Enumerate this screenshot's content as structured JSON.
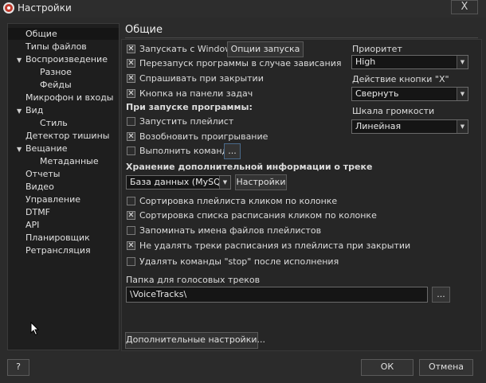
{
  "window": {
    "title": "Настройки",
    "close_label": "X"
  },
  "sidebar": {
    "items": [
      {
        "label": "Общие",
        "level": 0,
        "expander": ""
      },
      {
        "label": "Типы файлов",
        "level": 0,
        "expander": ""
      },
      {
        "label": "Воспроизведение",
        "level": 0,
        "expander": "▼"
      },
      {
        "label": "Разное",
        "level": 1,
        "expander": ""
      },
      {
        "label": "Фейды",
        "level": 1,
        "expander": ""
      },
      {
        "label": "Микрофон и входы",
        "level": 0,
        "expander": ""
      },
      {
        "label": "Вид",
        "level": 0,
        "expander": "▼"
      },
      {
        "label": "Стиль",
        "level": 1,
        "expander": ""
      },
      {
        "label": "Детектор тишины",
        "level": 0,
        "expander": ""
      },
      {
        "label": "Вещание",
        "level": 0,
        "expander": "▼"
      },
      {
        "label": "Метаданные",
        "level": 1,
        "expander": ""
      },
      {
        "label": "Отчеты",
        "level": 0,
        "expander": ""
      },
      {
        "label": "Видео",
        "level": 0,
        "expander": ""
      },
      {
        "label": "Управление",
        "level": 0,
        "expander": ""
      },
      {
        "label": "DTMF",
        "level": 0,
        "expander": ""
      },
      {
        "label": "API",
        "level": 0,
        "expander": ""
      },
      {
        "label": "Планировщик",
        "level": 0,
        "expander": ""
      },
      {
        "label": "Ретрансляция",
        "level": 0,
        "expander": ""
      }
    ]
  },
  "main": {
    "section_title": "Общие",
    "options": {
      "start_with_windows": "Запускать с Windows",
      "start_options_button": "Опции запуска",
      "restart_on_hang": "Перезапуск программы в случае зависания",
      "ask_on_close": "Спрашивать при закрытии",
      "taskbar_button": "Кнопка на панели задач"
    },
    "on_start": {
      "heading": "При запуске программы:",
      "run_playlist": "Запустить плейлист",
      "resume_playback": "Возобновить проигрывание",
      "run_command": "Выполнить команду",
      "browse_label": "..."
    },
    "storage": {
      "heading": "Хранение дополнительной информации о треке",
      "selected": "База данных (MySQL)",
      "settings_button": "Настройки"
    },
    "more_options": {
      "sort_playlist": "Сортировка плейлиста кликом по колонке",
      "sort_schedule": "Сортировка списка расписания кликом по колонке",
      "remember_names": "Запоминать имена файлов плейлистов",
      "keep_schedule_tracks": "Не удалять треки расписания из плейлиста при закрытии",
      "delete_stop": "Удалять команды \"stop\" после исполнения"
    },
    "voice_tracks": {
      "label": "Папка для голосовых треков",
      "value": "\\VoiceTracks\\",
      "browse_label": "..."
    },
    "advanced_button": "Дополнительные настройки...",
    "priority": {
      "label": "Приоритет",
      "value": "High"
    },
    "x_action": {
      "label": "Действие кнопки \"X\"",
      "value": "Свернуть"
    },
    "volume_scale": {
      "label": "Шкала громкости",
      "value": "Линейная"
    }
  },
  "footer": {
    "help_label": "?",
    "ok_label": "ОК",
    "cancel_label": "Отмена"
  }
}
